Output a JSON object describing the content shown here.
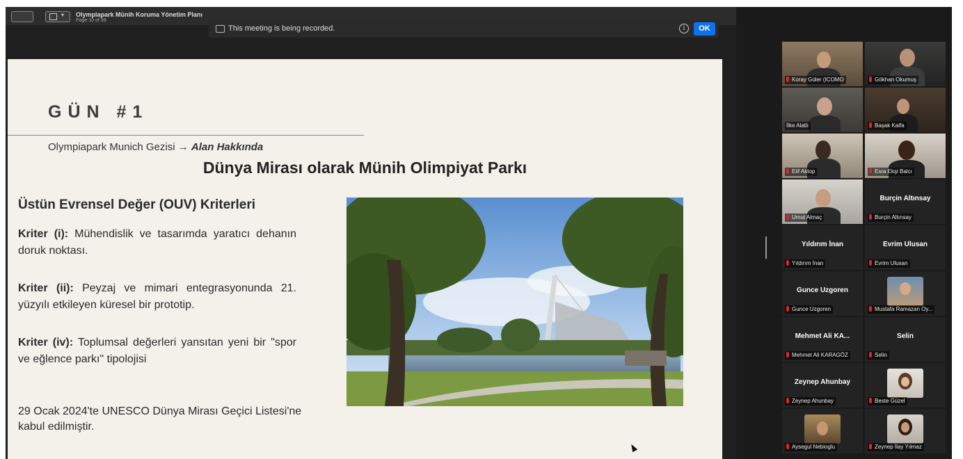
{
  "window": {
    "title": "Olympiapark Münih Koruma Yönetim Planı",
    "page_indicator": "Page 10 of 38"
  },
  "notice": {
    "text": "This meeting is being recorded.",
    "ok_label": "OK"
  },
  "slide": {
    "section": "GÜN #1",
    "subtitle_prefix": "Olympiapark Munich Gezisi →",
    "subtitle_emph": "Alan Hakkında",
    "heading": "Dünya Mirası olarak Münih Olimpiyat Parkı",
    "ouv_title": "Üstün Evrensel Değer (OUV) Kriterleri",
    "criteria": [
      {
        "label": "Kriter (i):",
        "text": "Mühendislik ve tasarımda yaratıcı dehanın doruk noktası."
      },
      {
        "label": "Kriter (ii):",
        "text": "Peyzaj ve mimari entegrasyonunda 21. yüzyılı etkileyen küresel bir prototip."
      },
      {
        "label": "Kriter (iv):",
        "text": "Toplumsal değerleri yansıtan yeni bir \"spor ve eğlence parkı\" tipolojisi"
      }
    ],
    "note": "29 Ocak 2024'te UNESCO Dünya Mirası Geçici Listesi'ne kabul edilmiştir."
  },
  "participants": [
    {
      "label": "Koray Güler (ICOMO",
      "video": true
    },
    {
      "label": "Gökhan Okumuş",
      "video": true
    },
    {
      "label": "İlke Alatlı",
      "video": true,
      "active": true
    },
    {
      "label": "Başak Kalfa",
      "video": true
    },
    {
      "label": "Elif Aktop",
      "video": true
    },
    {
      "label": "Esra Ekşi Balcı",
      "video": true
    },
    {
      "label": "Umut Almaç",
      "video": true
    },
    {
      "label": "Burçin Altınsay",
      "display": "Burçin Altınsay",
      "video": false
    },
    {
      "label": "Yıldırım İnan",
      "display": "Yıldırım İnan",
      "video": false
    },
    {
      "label": "Evrim Ulusan",
      "display": "Evrim Ulusan",
      "video": false
    },
    {
      "label": "Gunce Uzgoren",
      "display": "Gunce Uzgoren",
      "video": false
    },
    {
      "label": "Mustafa Ramazan Oy...",
      "video": true,
      "avatar": true
    },
    {
      "label": "Mehmet Ali KARAGÖZ",
      "display": "Mehmet Ali KA...",
      "video": false
    },
    {
      "label": "Selin",
      "display": "Selin",
      "video": false
    },
    {
      "label": "Zeynep Ahunbay",
      "display": "Zeynep Ahunbay",
      "video": false
    },
    {
      "label": "Beste Güzel",
      "video": true,
      "avatar": true
    },
    {
      "label": "Aysegul Nebioglu",
      "video": true,
      "avatar": true
    },
    {
      "label": "Zeynep İlay Yılmaz",
      "video": true,
      "avatar": true
    }
  ]
}
